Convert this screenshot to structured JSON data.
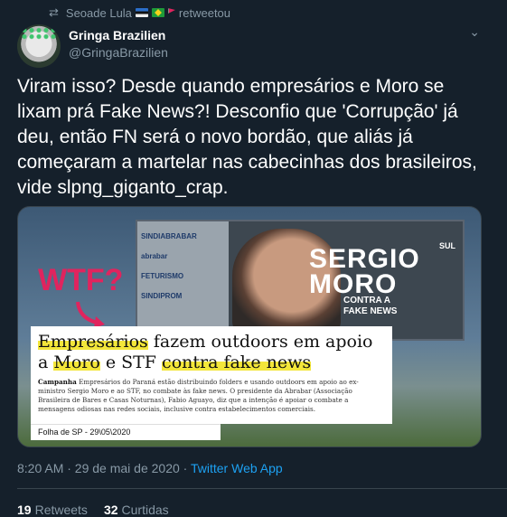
{
  "retweet": {
    "user": "Seoade Lula",
    "label": "retweetou"
  },
  "author": {
    "name": "Gringa Brazilien",
    "handle": "@GringaBrazilien"
  },
  "tweet_text": "Viram isso? Desde quando empresários e Moro se lixam prá Fake News?! Desconfio que 'Corrupção' já deu, então FN será o novo bordão, que aliás já começaram a martelar nas cabecinhas dos brasileiros, vide slpng_giganto_crap.",
  "media": {
    "overlay": "WTF?",
    "billboard": {
      "line1": "SERGIO",
      "line2": "MORO",
      "sub1": "CONTRA A",
      "sub2": "FAKE NEWS",
      "sponsor1": "SINDIABRABAR",
      "sponsor2": "abrabar",
      "sponsor3": "FETURISMO",
      "sponsor4": "SINDIPROM",
      "brand": "SUL"
    },
    "headline_p1": "Empresários",
    "headline_p2": " fazem outdoors em apoio a ",
    "headline_p3": "Moro",
    "headline_p4": " e STF ",
    "headline_p5": "contra fake news",
    "body_lead": "Campanha",
    "body": " Empresários do Paraná estão distribuindo folders e usando outdoors em apoio ao ex-ministro Sergio Moro e ao STF, no combate às fake news. O presidente da Abrabar (Associação Brasileira de Bares e Casas Noturnas), Fabio Aguayo, diz que a intenção é apoiar o combate a mensagens odiosas nas redes sociais, inclusive contra estabelecimentos comerciais.",
    "credit": "Folha de SP -  29\\05\\2020"
  },
  "meta": {
    "time": "8:20 AM · 29 de mai de 2020 · ",
    "source": "Twitter Web App"
  },
  "stats": {
    "retweets_count": "19",
    "retweets_label": "Retweets",
    "likes_count": "32",
    "likes_label": "Curtidas"
  }
}
